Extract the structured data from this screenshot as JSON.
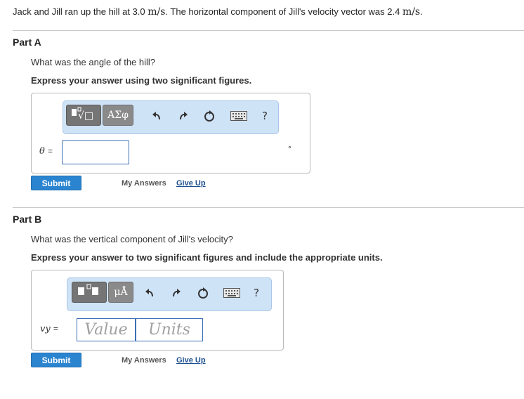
{
  "problem": {
    "text1": "Jack and Jill ran up the hill at 3.0 ",
    "unit1": "m/s",
    "text2": ". The horizontal component of Jill's velocity vector was 2.4 ",
    "unit2": "m/s",
    "text3": "."
  },
  "partA": {
    "title": "Part A",
    "question": "What was the angle of the hill?",
    "instruction": "Express your answer using two significant figures.",
    "toolbar": {
      "template_glyph": "√□",
      "greek_label": "ΑΣφ",
      "help_label": "?"
    },
    "variable_label": "θ",
    "equals": "=",
    "input_value": "",
    "unit_symbol": "°",
    "submit_label": "Submit",
    "my_answers_label": "My Answers",
    "give_up_label": "Give Up"
  },
  "partB": {
    "title": "Part B",
    "question": "What was the vertical component of Jill's velocity?",
    "instruction": "Express your answer to two significant figures and include the appropriate units.",
    "toolbar": {
      "units_label": "μÅ",
      "help_label": "?"
    },
    "variable_label": "vy",
    "equals": "=",
    "value_placeholder": "Value",
    "units_placeholder": "Units",
    "submit_label": "Submit",
    "my_answers_label": "My Answers",
    "give_up_label": "Give Up"
  },
  "colors": {
    "accent": "#2a84cf",
    "toolbar_bg": "#cfe3f7",
    "link": "#1c4f8f"
  }
}
